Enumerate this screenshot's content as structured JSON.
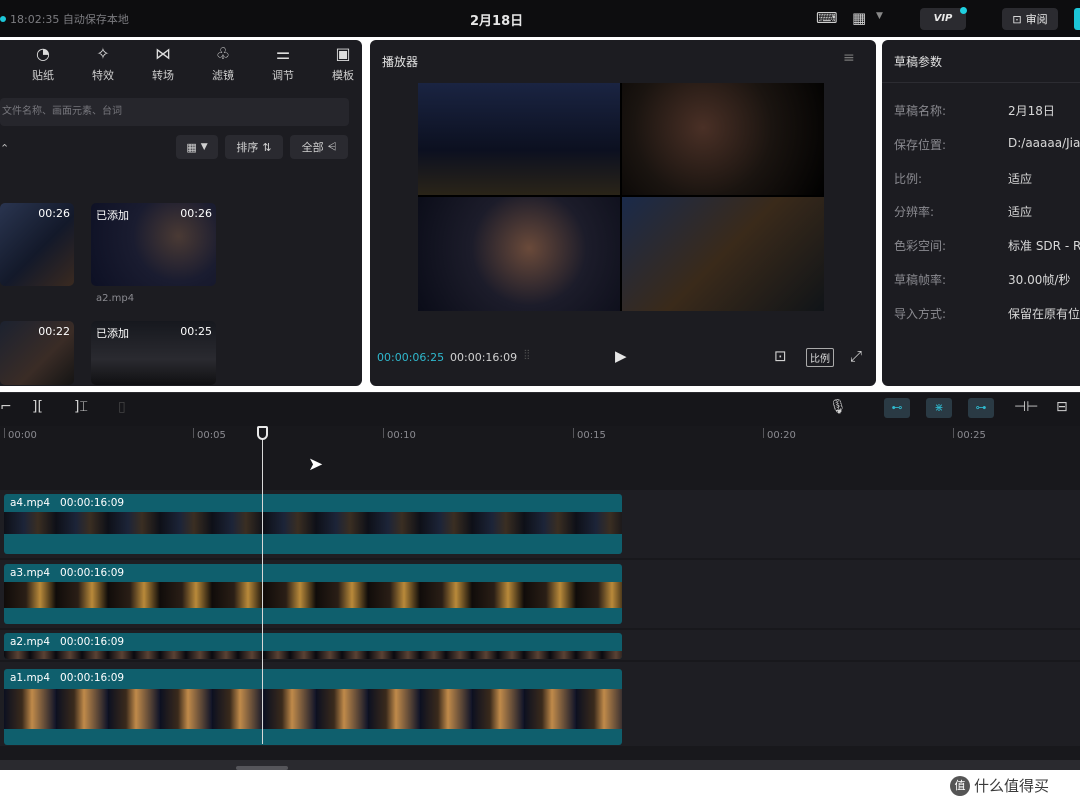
{
  "topbar": {
    "saved_text": "18:02:35 自动保存本地",
    "title": "2月18日",
    "vip_label": "VIP",
    "review_label": "审阅"
  },
  "media_panel": {
    "tools": [
      {
        "label": "贴纸",
        "icon": "sticker-icon",
        "glyph": "◔"
      },
      {
        "label": "特效",
        "icon": "effects-icon",
        "glyph": "✧"
      },
      {
        "label": "转场",
        "icon": "transition-icon",
        "glyph": "⋈"
      },
      {
        "label": "滤镜",
        "icon": "filter-icon",
        "glyph": "♧"
      },
      {
        "label": "调节",
        "icon": "adjust-icon",
        "glyph": "⚌"
      },
      {
        "label": "模板",
        "icon": "template-icon",
        "glyph": "▣"
      }
    ],
    "search_placeholder": "文件名称、画面元素、台词",
    "sort_label": "排序",
    "filter_label": "全部",
    "clips": [
      {
        "duration": "00:26",
        "added": "",
        "name": ""
      },
      {
        "duration": "00:26",
        "added": "已添加",
        "name": "a2.mp4"
      },
      {
        "duration": "00:22",
        "added": "",
        "name": ""
      },
      {
        "duration": "00:25",
        "added": "已添加",
        "name": ""
      }
    ]
  },
  "player": {
    "title": "播放器",
    "current_time": "00:00:06:25",
    "total_time": "00:00:16:09",
    "ratio_label": "比例"
  },
  "params": {
    "title": "草稿参数",
    "rows": [
      {
        "label": "草稿名称:",
        "value": "2月18日"
      },
      {
        "label": "保存位置:",
        "value": "D:/aaaaa/Jia"
      },
      {
        "label": "比例:",
        "value": "适应"
      },
      {
        "label": "分辨率:",
        "value": "适应"
      },
      {
        "label": "色彩空间:",
        "value": "标准 SDR - R"
      },
      {
        "label": "草稿帧率:",
        "value": "30.00帧/秒"
      },
      {
        "label": "导入方式:",
        "value": "保留在原有位"
      }
    ]
  },
  "timeline": {
    "ticks": [
      "00:00",
      "00:05",
      "00:10",
      "00:15",
      "00:20",
      "00:25"
    ],
    "tracks": [
      {
        "name": "a4.mp4",
        "duration": "00:00:16:09"
      },
      {
        "name": "a3.mp4",
        "duration": "00:00:16:09"
      },
      {
        "name": "a2.mp4",
        "duration": "00:00:16:09"
      },
      {
        "name": "a1.mp4",
        "duration": "00:00:16:09"
      }
    ]
  },
  "watermark": {
    "text": "什么值得买",
    "icon_text": "值"
  },
  "colors": {
    "accent": "#1cc6d8",
    "clip": "#0f5f6d",
    "panel": "#1c1c21"
  }
}
